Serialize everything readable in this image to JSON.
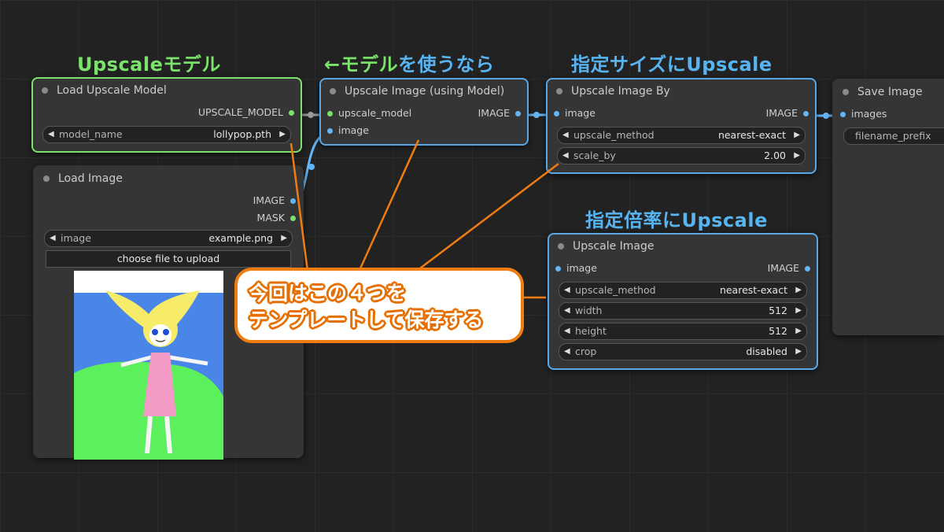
{
  "headings": {
    "upscale_model": "Upscaleモデル",
    "use_model_arrow": "←モデル",
    "use_model_rest": "を使うなら",
    "specified_size": "指定サイズにUpscale",
    "specified_ratio": "指定倍率にUpscale"
  },
  "callout": {
    "line1": "今回はこの４つを",
    "line2": "テンプレートして保存する"
  },
  "nodes": {
    "load_upscale_model": {
      "title": "Load Upscale Model",
      "output": "UPSCALE_MODEL",
      "widget_name": "model_name",
      "widget_value": "lollypop.pth"
    },
    "load_image": {
      "title": "Load Image",
      "output_image": "IMAGE",
      "output_mask": "MASK",
      "widget_name": "image",
      "widget_value": "example.png",
      "upload_button": "choose file to upload"
    },
    "upscale_using_model": {
      "title": "Upscale Image (using Model)",
      "input_model": "upscale_model",
      "input_image": "image",
      "output": "IMAGE"
    },
    "upscale_by": {
      "title": "Upscale Image By",
      "input": "image",
      "output": "IMAGE",
      "method_name": "upscale_method",
      "method_value": "nearest-exact",
      "scale_name": "scale_by",
      "scale_value": "2.00"
    },
    "upscale_image": {
      "title": "Upscale Image",
      "input": "image",
      "output": "IMAGE",
      "method_name": "upscale_method",
      "method_value": "nearest-exact",
      "width_name": "width",
      "width_value": "512",
      "height_name": "height",
      "height_value": "512",
      "crop_name": "crop",
      "crop_value": "disabled"
    },
    "save_image": {
      "title": "Save Image",
      "input": "images",
      "widget_name": "filename_prefix"
    }
  },
  "colors": {
    "heading_green": "#7be36b",
    "heading_blue": "#58b4f0",
    "callout_orange": "#ef7d12",
    "node_border_blue": "#58a8e8",
    "node_border_green": "#7be36b"
  }
}
